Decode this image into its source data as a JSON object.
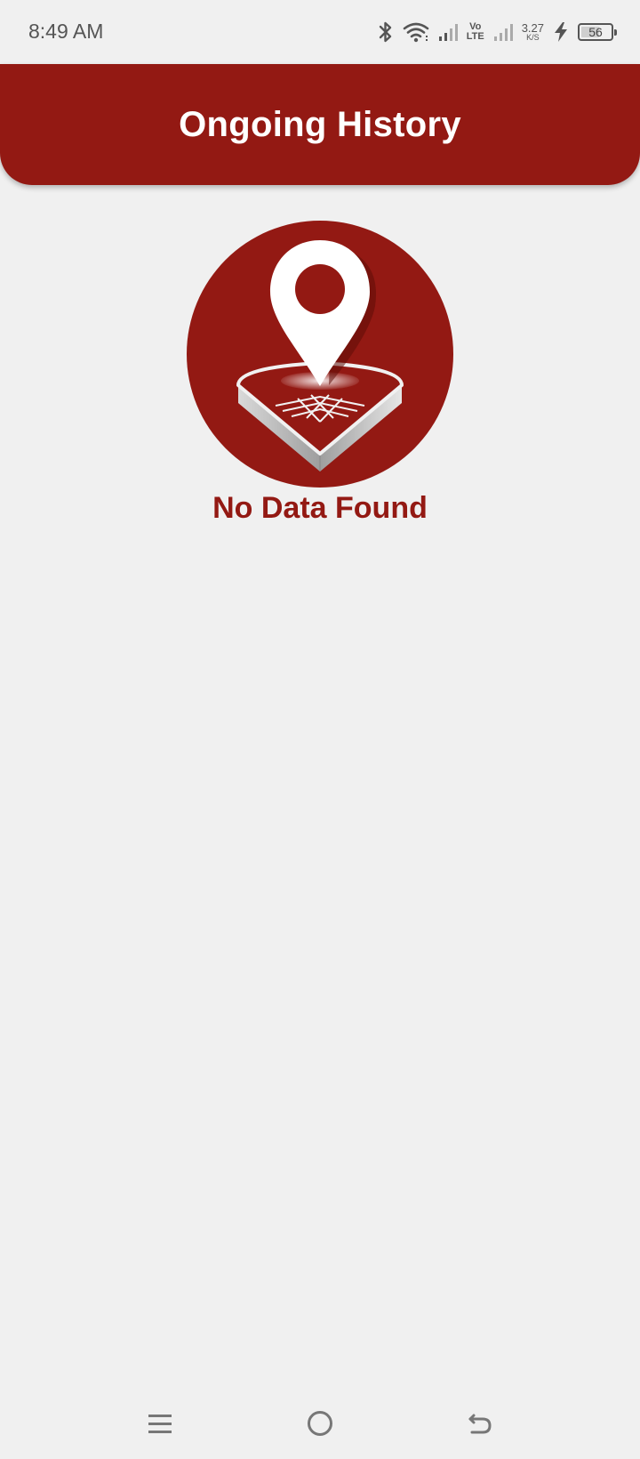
{
  "status_bar": {
    "time": "8:49 AM",
    "volte_top": "Vo",
    "volte_bottom": "LTE",
    "net_speed_value": "3.27",
    "net_speed_unit": "K/S",
    "battery_level": "56"
  },
  "header": {
    "title": "Ongoing History"
  },
  "empty_state": {
    "message": "No Data Found"
  },
  "colors": {
    "brand": "#931913",
    "background": "#f0f0f0"
  },
  "nav_bar": {
    "buttons": [
      "menu-icon",
      "home-icon",
      "back-icon"
    ]
  }
}
